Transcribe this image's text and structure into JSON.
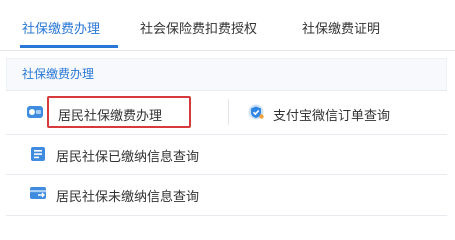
{
  "tabs": [
    {
      "label": "社保缴费办理",
      "active": true
    },
    {
      "label": "社会保险费扣费授权",
      "active": false
    },
    {
      "label": "社保缴费证明",
      "active": false
    }
  ],
  "section": {
    "title": "社保缴费办理"
  },
  "items": [
    {
      "label": "居民社保缴费办理",
      "icon": "cash-card-icon"
    },
    {
      "label": "支付宝微信订单查询",
      "icon": "shield-check-icon"
    },
    {
      "label": "居民社保已缴纳信息查询",
      "icon": "document-list-icon"
    },
    {
      "label": "居民社保未缴纳信息查询",
      "icon": "card-arrow-icon"
    }
  ],
  "colors": {
    "accent": "#2a78d6",
    "highlight": "#d63a3a"
  }
}
